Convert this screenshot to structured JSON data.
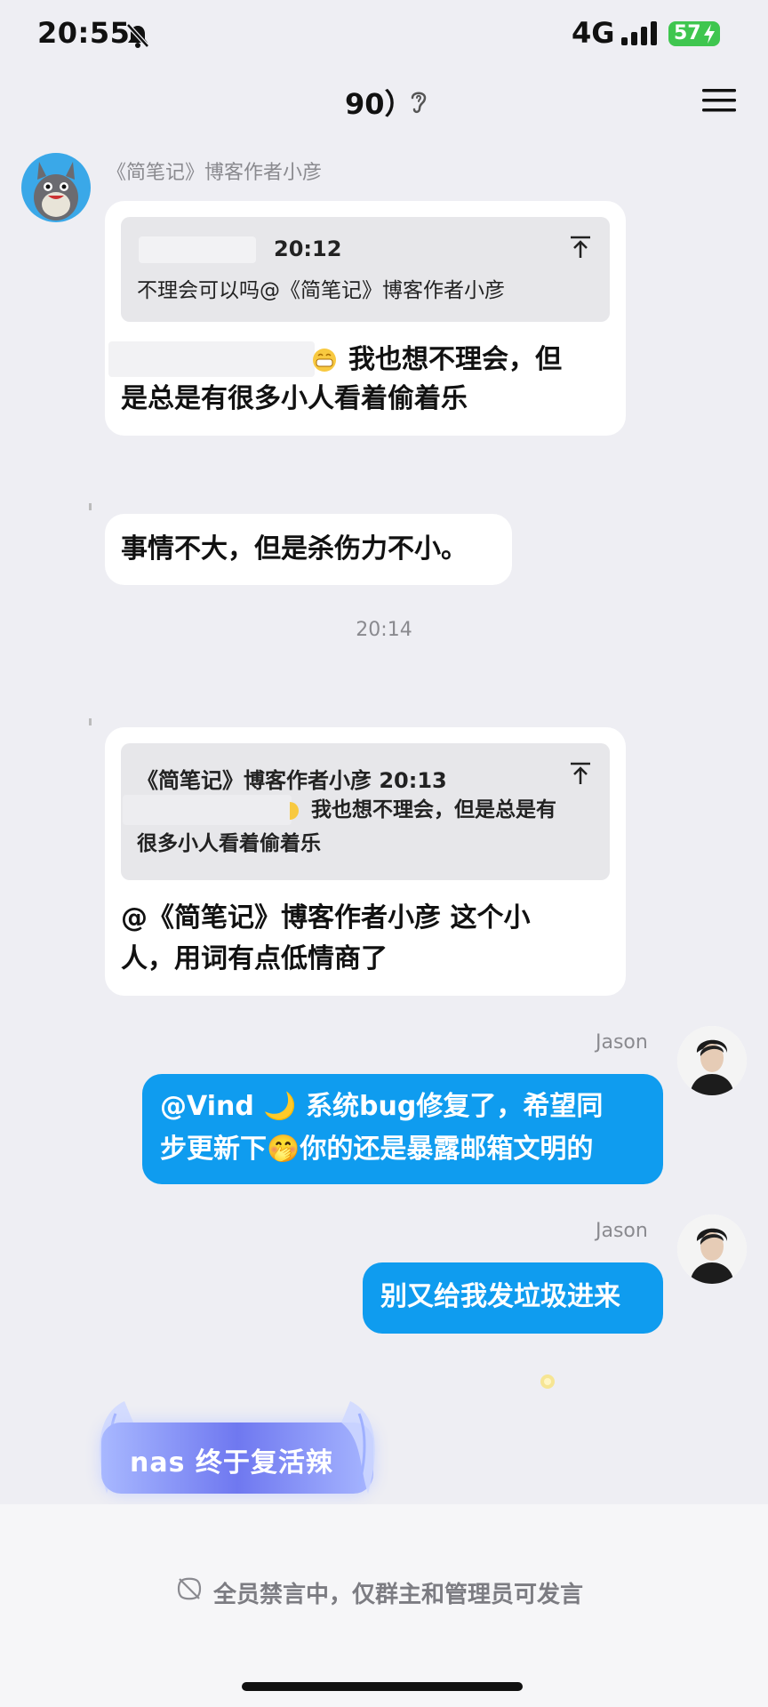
{
  "status_bar": {
    "time": "20:55",
    "network": "4G",
    "battery": "57"
  },
  "nav": {
    "title": "90）"
  },
  "messages": {
    "msg1": {
      "sender": "《简笔记》博客作者小彦",
      "quote_time": "20:12",
      "quote_text": "不理会可以吗@《简笔记》博客作者小彦",
      "line1": "我也想不理会，但",
      "line2": "是总是有很多小人看着偷着乐"
    },
    "msg2": {
      "text": "事情不大，但是杀伤力不小。"
    },
    "time_divider": "20:14",
    "msg3": {
      "quote_head": "《简笔记》博客作者小彦 20:13",
      "quote_line1": "我也想不理会，但是总是有",
      "quote_line2": "很多小人看着偷着乐",
      "line1": "@《简笔记》博客作者小彦 这个小",
      "line2": "人，用词有点低情商了"
    },
    "msg4": {
      "sender": "Jason",
      "line1": "@Vind 🌙 系统bug修复了，希望同",
      "line2": "步更新下🤭你的还是暴露邮箱文明的"
    },
    "msg5": {
      "sender": "Jason",
      "text": "别又给我发垃圾进来"
    },
    "sticker": {
      "text": "nas 终于复活辣"
    }
  },
  "footer": {
    "notice": "全员禁言中，仅群主和管理员可发言"
  },
  "colors": {
    "accent": "#0f9cef",
    "battery": "#3fc64f",
    "background": "#eeeef3"
  },
  "icons": [
    "bell-off-icon",
    "signal-icon",
    "ear-icon",
    "menu-icon",
    "pin-icon",
    "mute-icon"
  ]
}
